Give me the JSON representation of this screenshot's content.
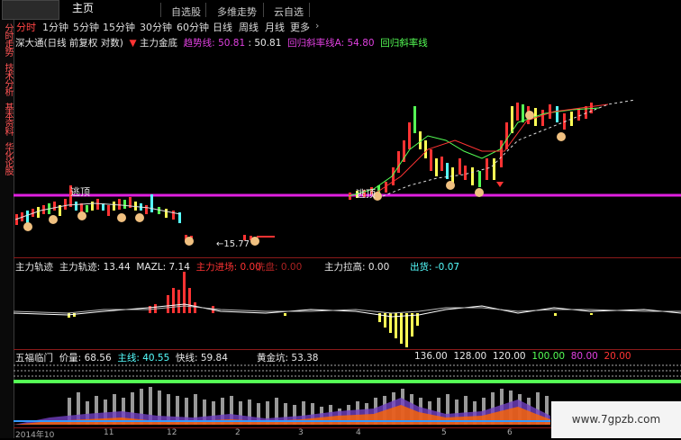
{
  "header": {
    "home_label": "主页",
    "buttons": [
      "自选股",
      "多维走势",
      "云自选"
    ]
  },
  "period_tabs": [
    "分时",
    "1分钟",
    "5分钟",
    "15分钟",
    "30分钟",
    "60分钟",
    "日线",
    "周线",
    "月线",
    "更多"
  ],
  "active_tab": "分时",
  "sidebar": [
    "分时走势",
    "技术分析",
    "基本资料",
    "华化论股"
  ],
  "main_chart": {
    "stock_title": "深大通(日线 前复权 对数)",
    "indicator_name": "主力金底",
    "trend_label": "趋势线:",
    "trend_value": "50.81",
    "trend_value2": "50.81",
    "reg_a_label": "回归斜率线A:",
    "reg_a_value": "54.80",
    "reg_b_label": "回归斜率线",
    "annotation_top": "逃顶",
    "annotation_top2": "逃顶",
    "price_marker": "←15.77"
  },
  "sub1": {
    "label": "主力轨迹",
    "track_label": "主力轨迹:",
    "track_value": "13.44",
    "mazl_label": "MAZL:",
    "mazl_value": "7.14",
    "enter_label": "主力进场:",
    "enter_value": "0.00",
    "wash_label": "洗盘:",
    "wash_value": "0.00",
    "pull_label": "主力拉高:",
    "pull_value": "0.00",
    "ship_label": "出货:",
    "ship_value": "-0.07"
  },
  "sub2": {
    "label": "五福临门",
    "price_label": "价量:",
    "price_value": "68.56",
    "main_label": "主线:",
    "main_value": "40.55",
    "fast_label": "快线:",
    "fast_value": "59.84",
    "gold_label": "黄金坑:",
    "gold_value": "53.38",
    "levels": [
      "136.00",
      "128.00",
      "120.00",
      "100.00",
      "80.00",
      "20.00"
    ]
  },
  "x_axis": [
    "2014年10",
    "11",
    "12",
    "2",
    "3",
    "4",
    "5",
    "6"
  ],
  "watermark": "www.7gpzb.com",
  "colors": {
    "bg": "#000000",
    "magenta_line": "#e020e0",
    "up": "#ff3333",
    "down": "#55ffff",
    "divider": "#8b1a1a"
  }
}
